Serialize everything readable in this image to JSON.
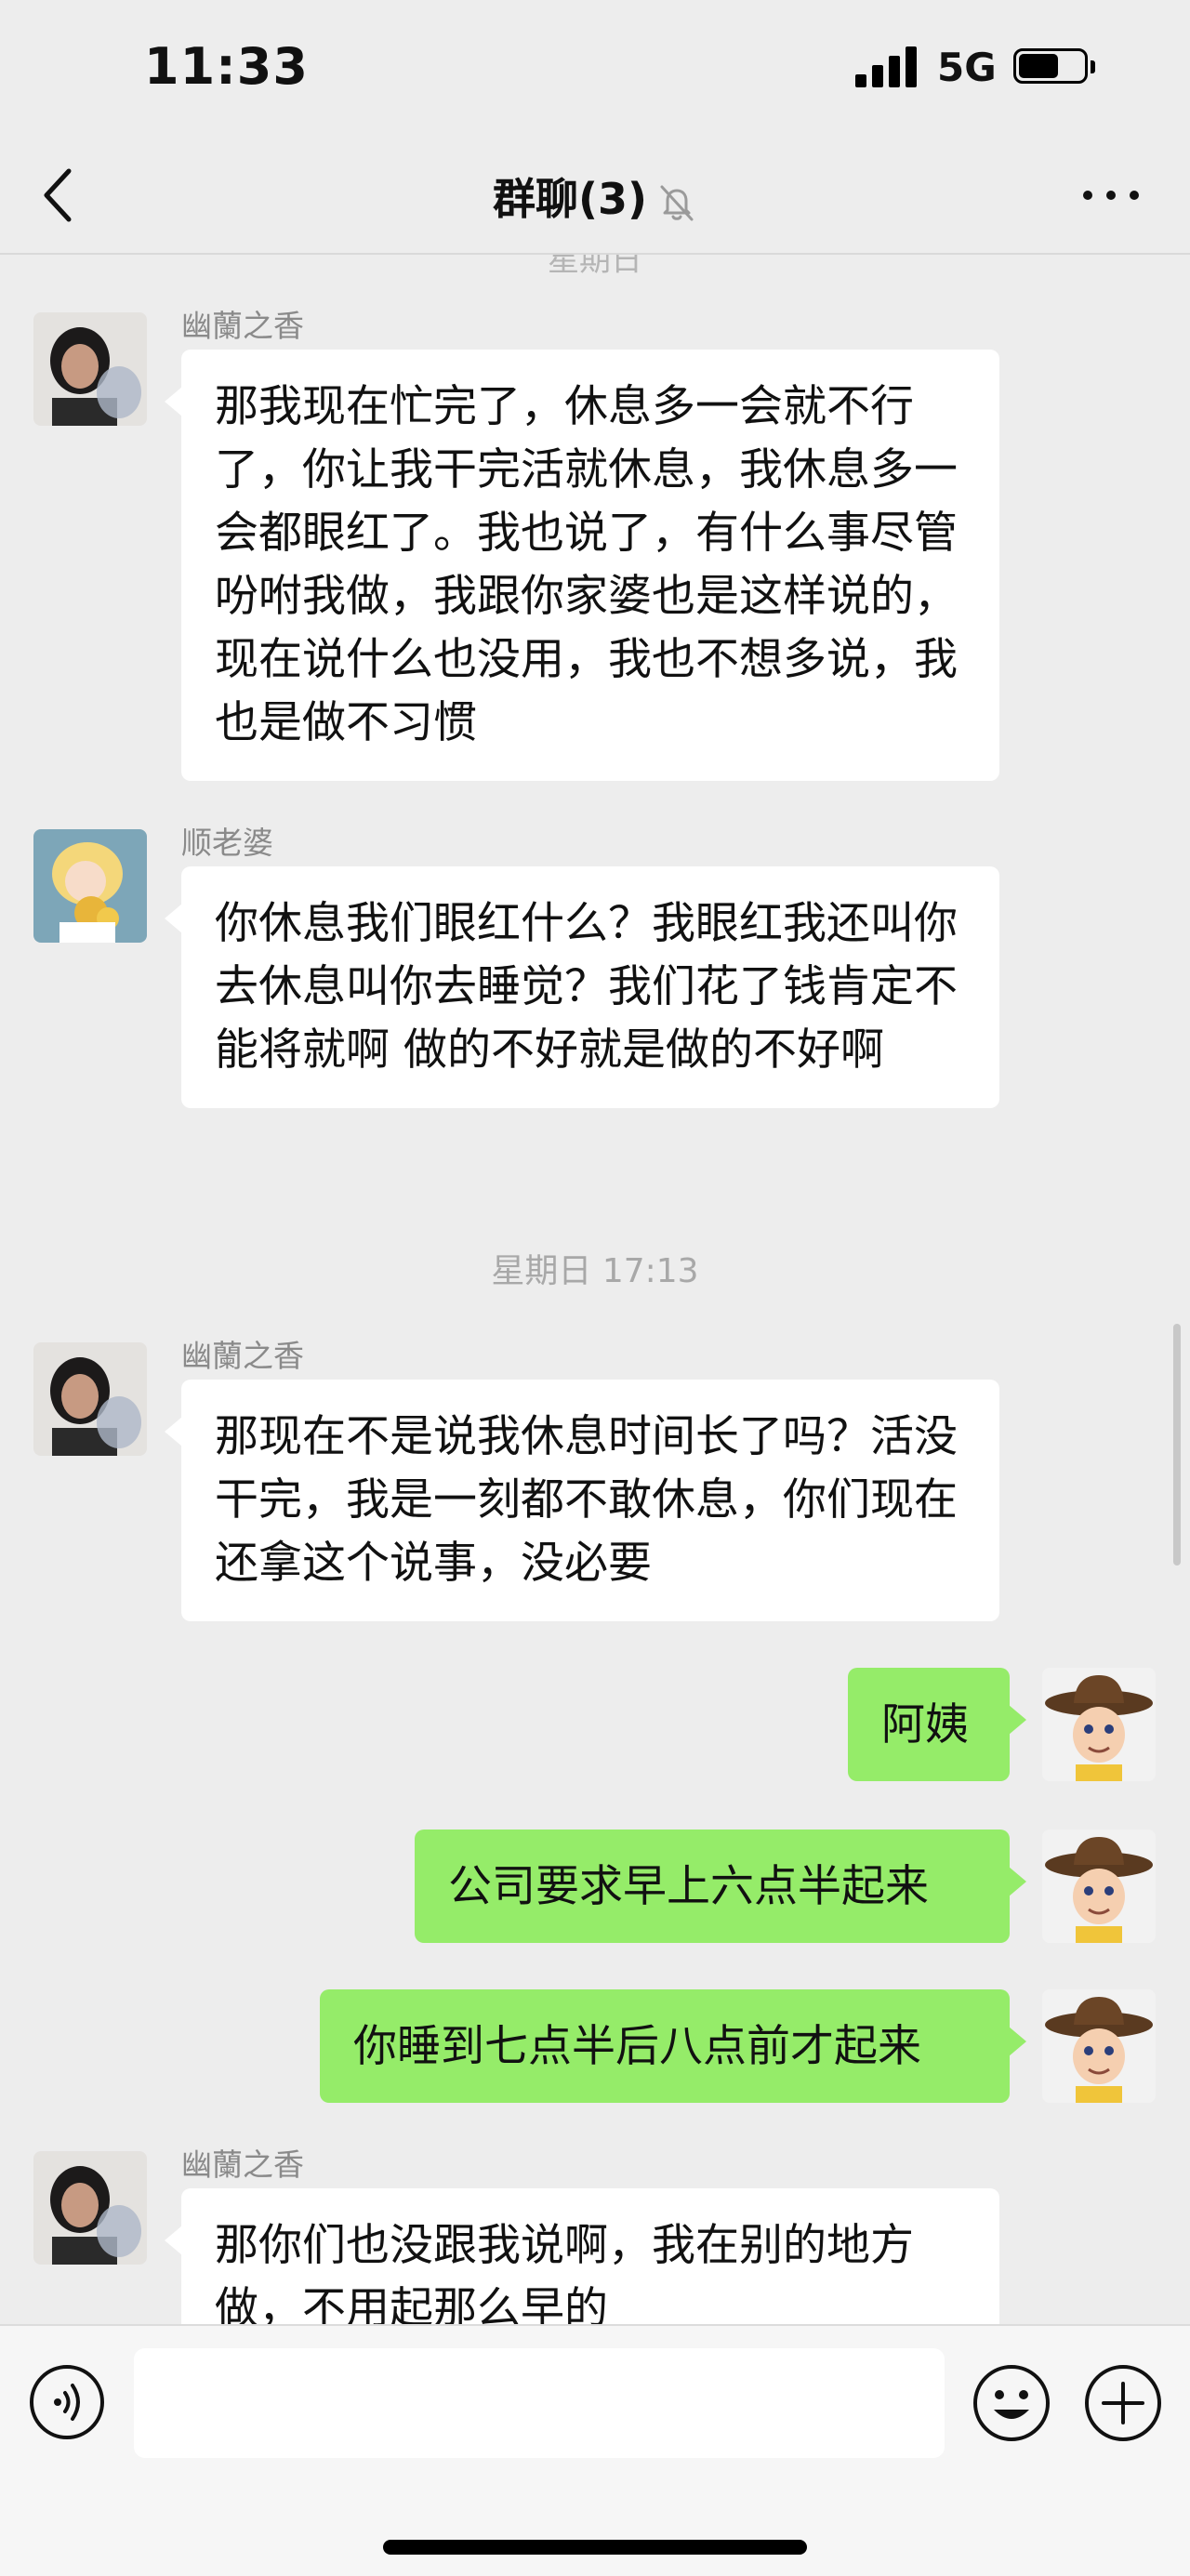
{
  "status_bar": {
    "time": "11:33",
    "network": "5G"
  },
  "nav": {
    "title": "群聊(3)",
    "back_icon": "chevron-left-icon",
    "mute_icon": "bell-off-icon",
    "more_icon": "ellipsis-icon"
  },
  "chat": {
    "top_cut_timestamp": "星期日",
    "messages": [
      {
        "sender": "幽蘭之香",
        "text": "那我现在忙完了，休息多一会就不行了，你让我干完活就休息，我休息多一会都眼红了。我也说了，有什么事尽管吩咐我做，我跟你家婆也是这样说的，现在说什么也没用，我也不想多说，我也是做不习惯"
      },
      {
        "sender": "顺老婆",
        "text": "你休息我们眼红什么？我眼红我还叫你去休息叫你去睡觉？我们花了钱肯定不能将就啊 做的不好就是做的不好啊"
      },
      {
        "timestamp": "星期日 17:13"
      },
      {
        "sender": "幽蘭之香",
        "text": "那现在不是说我休息时间长了吗？活没干完，我是一刻都不敢休息，你们现在还拿这个说事，没必要"
      },
      {
        "self": true,
        "text": "阿姨"
      },
      {
        "self": true,
        "text": "公司要求早上六点半起来"
      },
      {
        "self": true,
        "text": "你睡到七点半后八点前才起来"
      },
      {
        "sender": "幽蘭之香",
        "text": "那你们也没跟我说啊，我在别的地方做，不用起那么早的"
      }
    ]
  },
  "input_bar": {
    "voice_icon": "voice-icon",
    "emoji_icon": "emoji-icon",
    "plus_icon": "plus-icon",
    "placeholder": ""
  },
  "colors": {
    "background": "#ededed",
    "self_bubble": "#95ec69",
    "other_bubble": "#ffffff"
  }
}
